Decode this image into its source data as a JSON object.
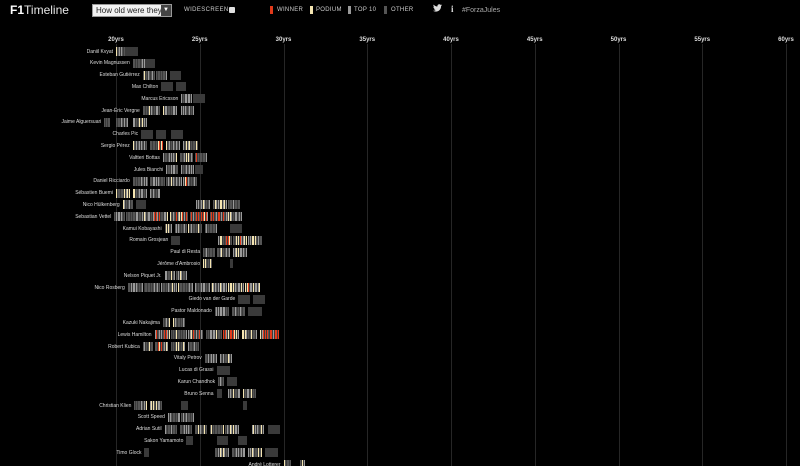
{
  "header": {
    "logo_bold": "F1",
    "logo_light": "Timeline",
    "select_value": "How old were they?",
    "widescreen_label": "WIDESCREEN",
    "legend": [
      {
        "label": "WINNER",
        "color": "#e23a1a"
      },
      {
        "label": "PODIUM",
        "color": "#f4e4b0"
      },
      {
        "label": "TOP 10",
        "color": "#9a9a9a"
      },
      {
        "label": "OTHER",
        "color": "#555555"
      }
    ],
    "social": {
      "twitter": "twitter-icon",
      "info": "info-icon"
    },
    "hashtag": "#ForzaJules"
  },
  "age_axis": [
    "20yrs",
    "25yrs",
    "30yrs",
    "35yrs",
    "40yrs",
    "45yrs",
    "50yrs",
    "55yrs",
    "60yrs"
  ],
  "colors": {
    "winner": "#e23a1a",
    "podium": "#f4e4b0",
    "top10": "#9a9a9a",
    "other": "#555555",
    "gap": "#3a3a3a",
    "gridline": "#262626"
  },
  "drivers": [
    "Daniil Kvyat",
    "Kevin Magnussen",
    "Esteban Gutiérrez",
    "Max Chilton",
    "Marcus Ericsson",
    "Jean-Éric Vergne",
    "Jaime Alguersuari",
    "Charles Pic",
    "Sergio Pérez",
    "Valtteri Bottas",
    "Jules Bianchi",
    "Daniel Ricciardo",
    "Sébastien Buemi",
    "Nico Hülkenberg",
    "Sebastian Vettel",
    "Kamui Kobayashi",
    "Romain Grosjean",
    "Paul di Resta",
    "Jérôme d'Ambrosio",
    "Nelson Piquet Jr.",
    "Nico Rosberg",
    "Giedo van der Garde",
    "Pastor Maldonado",
    "Kazuki Nakajima",
    "Lewis Hamilton",
    "Robert Kubica",
    "Vitaly Petrov",
    "Lucas di Grassi",
    "Karun Chandhok",
    "Bruno Senna",
    "Christian Klien",
    "Scott Speed",
    "Adrian Sutil",
    "Sakon Yamamoto",
    "Timo Glock",
    "André Lotterer"
  ]
}
